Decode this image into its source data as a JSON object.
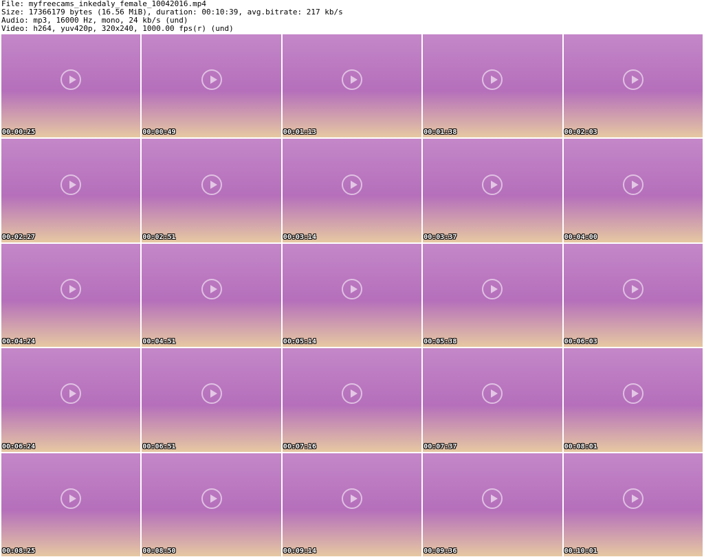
{
  "header": {
    "file_line": "File: myfreecams_inkedaly_female_10042016.mp4",
    "size_line": "Size: 17366179 bytes (16.56 MiB), duration: 00:10:39, avg.bitrate: 217 kb/s",
    "audio_line": "Audio: mp3, 16000 Hz, mono, 24 kb/s (und)",
    "video_line": "Video: h264, yuv420p, 320x240, 1000.00 fps(r) (und)"
  },
  "thumbnails": [
    "00:00:25",
    "00:00:49",
    "00:01:13",
    "00:01:38",
    "00:02:03",
    "00:02:27",
    "00:02:51",
    "00:03:14",
    "00:03:37",
    "00:04:00",
    "00:04:24",
    "00:04:51",
    "00:05:14",
    "00:05:38",
    "00:06:03",
    "00:06:24",
    "00:06:51",
    "00:07:16",
    "00:07:37",
    "00:08:01",
    "00:08:25",
    "00:08:50",
    "00:09:14",
    "00:09:36",
    "00:10:01"
  ]
}
